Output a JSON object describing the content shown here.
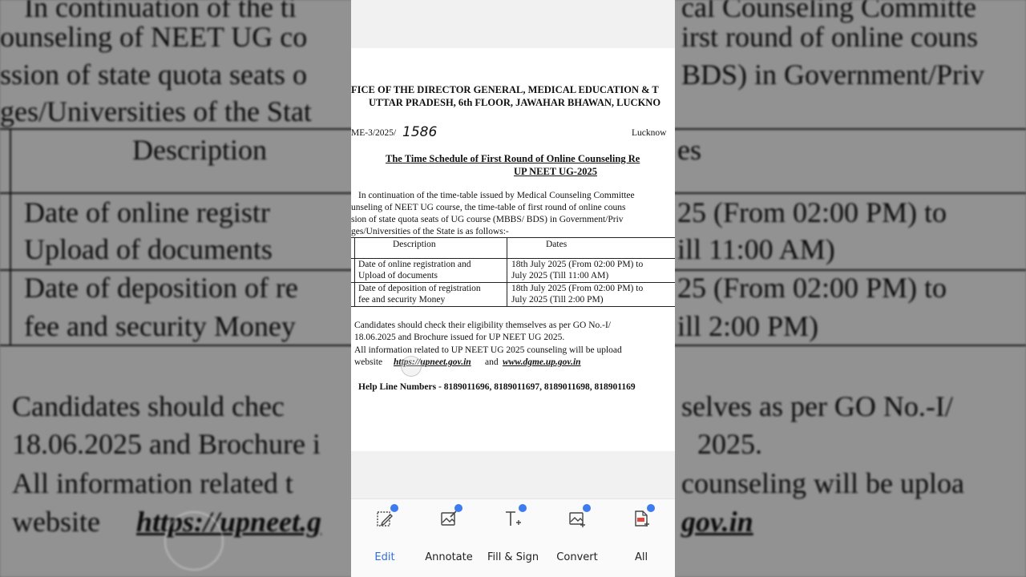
{
  "document": {
    "header_line1": "FICE OF THE DIRECTOR GENERAL, MEDICAL EDUCATION & T",
    "header_line2": "UTTAR PRADESH, 6th FLOOR, JAWAHAR BHAWAN, LUCKNO",
    "ref_no": "ME-3/2025/",
    "ref_handwritten": "1586",
    "place": "Lucknow",
    "title_line1": "The Time Schedule of First Round of Online Counseling Re",
    "title_line2": "UP NEET UG-2025",
    "intro": [
      "In continuation of the time-table issued by Medical Counseling Committee",
      "unseling of NEET UG course, the time-table of first round of online couns",
      "sion of state quota seats of UG course (MBBS/ BDS)  in Government/Priv",
      "ges/Universities of the State is as follows:-"
    ],
    "table": {
      "headers": [
        "Description",
        "Dates"
      ],
      "rows": [
        {
          "desc1": "Date of online   registration and",
          "desc2": "Upload of documents",
          "date1": "18th  July 2025 (From 02:00 PM)  to",
          "date2": "July 2025 (Till 11:00 AM)"
        },
        {
          "desc1": "Date of deposition of registration",
          "desc2": "fee and security Money",
          "date1": "18th  July 2025 (From 02:00 PM)  to",
          "date2": "July 2025 (Till  2:00 PM)"
        }
      ]
    },
    "notes": [
      "Candidates should check their eligibility themselves as per GO No.-I/",
      "18.06.2025 and Brochure issued for UP NEET UG 2025.",
      "All information related to UP NEET UG 2025 counseling  will be upload"
    ],
    "website_label": "website",
    "link1": "https://upneet.gov.in",
    "and_text": "and",
    "link2": "www.dgme.up.gov.in",
    "helpline": "Help Line Numbers - 8189011696, 8189011697, 8189011698, 818901169"
  },
  "background": {
    "line1": "In continuation of the ti",
    "line1b": "cal Counseling Committe",
    "line2": "ounseling of NEET UG co",
    "line2b": "irst round of online couns",
    "line3": "ssion of state quota seats o",
    "line3b": "BDS)  in Government/Priv",
    "line4": "ges/Universities of the Stat",
    "col_desc": "Description",
    "col_dates": "es",
    "r1a": "Date of online   registr",
    "r1b": "Upload of documents",
    "r1c": "25 (From 02:00 PM)  to",
    "r1d": "ill 11:00 AM)",
    "r2a": "Date of deposition of re",
    "r2b": "fee and security Money",
    "r2c": "25 (From 02:00 PM)  to",
    "r2d": "ill  2:00 PM)",
    "n1": "Candidates should chec",
    "n1b": "selves as per GO No.-I/",
    "n2": "18.06.2025 and Brochure i",
    "n2b": "2025.",
    "n3": "All information related t",
    "n3b": "counseling   will be uploa",
    "n4": "website",
    "n4link": "https://upneet.g",
    "n4b": "gov.in"
  },
  "toolbar": {
    "accent": "#2f6fe0",
    "items": [
      {
        "label": "Edit",
        "icon": "edit-page-icon"
      },
      {
        "label": "Annotate",
        "icon": "annotate-image-icon"
      },
      {
        "label": "Fill & Sign",
        "icon": "text-add-icon"
      },
      {
        "label": "Convert",
        "icon": "image-add-icon"
      },
      {
        "label": "All",
        "icon": "pdf-document-icon"
      }
    ]
  }
}
